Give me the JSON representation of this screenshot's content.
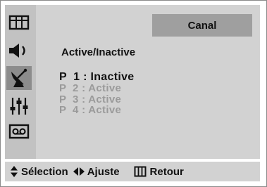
{
  "header": {
    "title": "Canal"
  },
  "section": {
    "title": "Active/Inactive"
  },
  "programs": [
    {
      "text": "P  1 : Inactive",
      "state": "selected"
    },
    {
      "text": "P  2 : Active",
      "state": "dim"
    },
    {
      "text": "P  3 : Active",
      "state": "dim"
    },
    {
      "text": "P  4 : Active",
      "state": "dim"
    }
  ],
  "sidebar": {
    "items": [
      {
        "icon": "picture-icon"
      },
      {
        "icon": "speaker-icon"
      },
      {
        "icon": "satellite-dish-icon",
        "active": true
      },
      {
        "icon": "equalizer-icon"
      },
      {
        "icon": "cassette-icon"
      }
    ]
  },
  "footer": {
    "select_icon": "up-down-arrows-icon",
    "select_label": "Sélection",
    "adjust_icon": "left-right-arrows-icon",
    "adjust_label": "Ajuste",
    "return_icon": "menu-grid-icon",
    "return_label": "Retour"
  },
  "colors": {
    "panel": "#d2d2d2",
    "sidebar": "#c2c2c2",
    "active_item": "#8c8c8c",
    "header": "#9f9f9f",
    "text": "#111111",
    "dim_text": "#9a9a9a"
  }
}
